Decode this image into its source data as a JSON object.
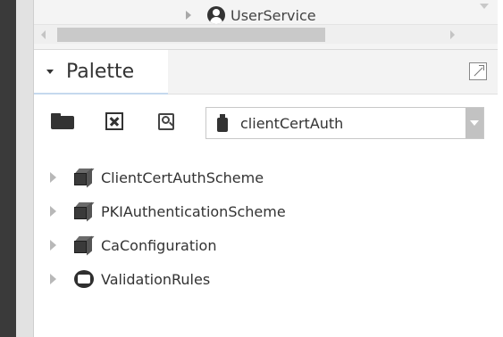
{
  "top_tree": {
    "item_label": "UserService"
  },
  "palette": {
    "title": "Palette"
  },
  "toolbar": {
    "dropdown_value": "clientCertAuth"
  },
  "tree_items": [
    {
      "label": "ClientCertAuthScheme",
      "icon": "cube-icon"
    },
    {
      "label": "PKIAuthenticationScheme",
      "icon": "cube-icon"
    },
    {
      "label": "CaConfiguration",
      "icon": "cube-icon"
    },
    {
      "label": "ValidationRules",
      "icon": "folder-round-icon"
    }
  ]
}
